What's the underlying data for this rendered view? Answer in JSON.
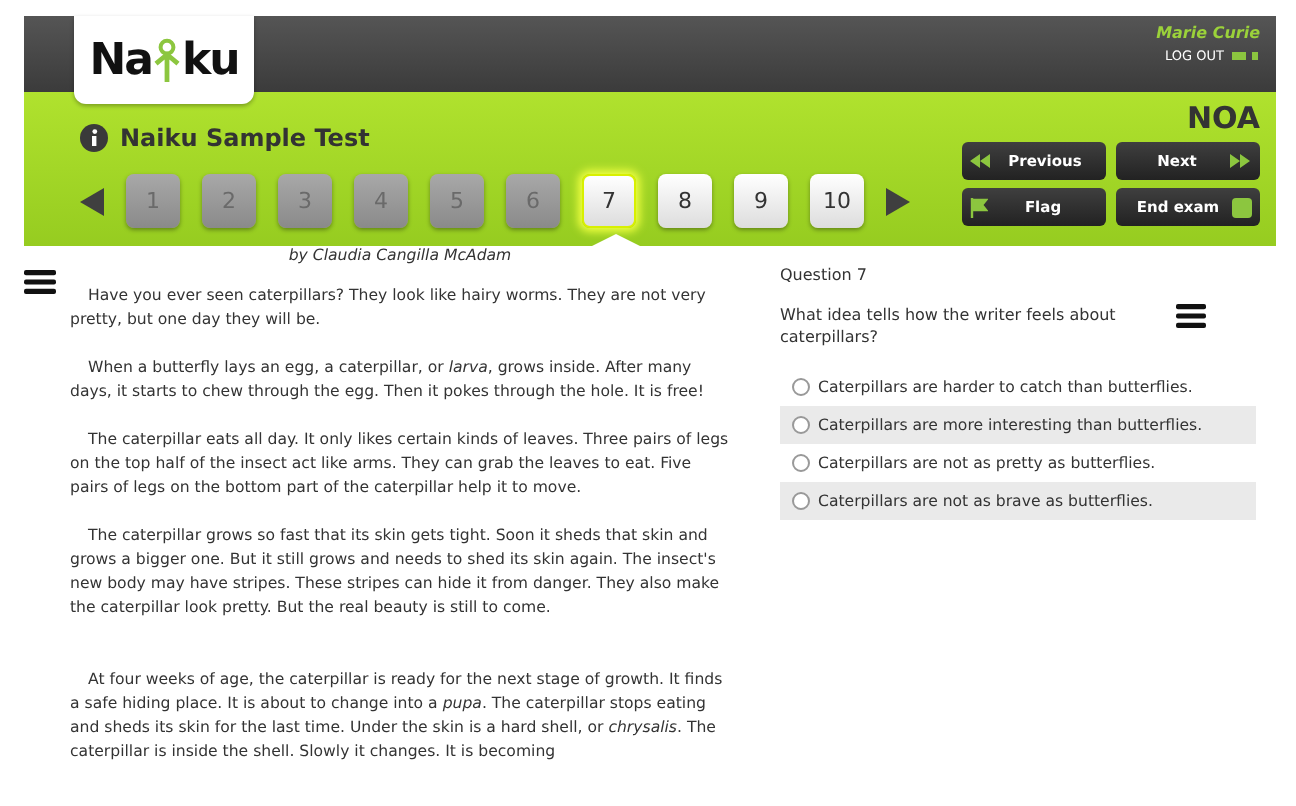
{
  "logo": {
    "text_before": "Na",
    "text_after": "ku"
  },
  "user": {
    "name": "Marie Curie",
    "logout": "LOG OUT"
  },
  "test": {
    "title": "Naiku Sample Test",
    "code": "NOA"
  },
  "pager": [
    {
      "label": "1",
      "done": true,
      "selected": false
    },
    {
      "label": "2",
      "done": true,
      "selected": false
    },
    {
      "label": "3",
      "done": true,
      "selected": false
    },
    {
      "label": "4",
      "done": true,
      "selected": false
    },
    {
      "label": "5",
      "done": true,
      "selected": false
    },
    {
      "label": "6",
      "done": true,
      "selected": false
    },
    {
      "label": "7",
      "done": false,
      "selected": true
    },
    {
      "label": "8",
      "done": false,
      "selected": false
    },
    {
      "label": "9",
      "done": false,
      "selected": false
    },
    {
      "label": "10",
      "done": false,
      "selected": false
    }
  ],
  "buttons": [
    {
      "label": "Previous",
      "kind": "previous"
    },
    {
      "label": "Next",
      "kind": "next"
    },
    {
      "label": "Flag",
      "kind": "flag"
    },
    {
      "label": "End exam",
      "kind": "end"
    }
  ],
  "passage": {
    "byline": "by Claudia Cangilla McAdam",
    "paragraphs": [
      "Have you ever seen caterpillars? They look like hairy worms. They are not very pretty, but one day they will be.",
      "When a butterfly lays an egg, a caterpillar, or *larva*, grows inside. After many days, it starts to chew through the egg. Then it pokes through the hole. It is free!",
      "The caterpillar eats all day. It only likes certain kinds of leaves. Three pairs of legs on the top half of the insect act like arms. They can grab the leaves to eat. Five pairs of legs on the bottom part of the caterpillar help it to move.",
      "The caterpillar grows so fast that its skin gets tight. Soon it sheds that skin and grows a bigger one. But it still grows and needs to shed its skin again. The insect's new body may have stripes. These stripes can hide it from danger. They also make the caterpillar look pretty. But the real beauty is still to come.",
      "At four weeks of age, the caterpillar is ready for the next stage of growth. It finds a safe hiding place. It is about to change into a *pupa*. The caterpillar stops eating and sheds its skin for the last time. Under the skin is a hard shell, or *chrysalis*. The caterpillar is inside the shell. Slowly it changes. It is becoming"
    ]
  },
  "question": {
    "number": "Question 7",
    "prompt": "What idea tells how the writer feels about caterpillars?",
    "options": [
      {
        "text": "Caterpillars are harder to catch than butterflies.",
        "selected": false
      },
      {
        "text": "Caterpillars are more interesting than butterflies.",
        "selected": false
      },
      {
        "text": "Caterpillars are not as pretty as butterflies.",
        "selected": false
      },
      {
        "text": "Caterpillars are not as brave as butterflies.",
        "selected": false
      }
    ]
  }
}
